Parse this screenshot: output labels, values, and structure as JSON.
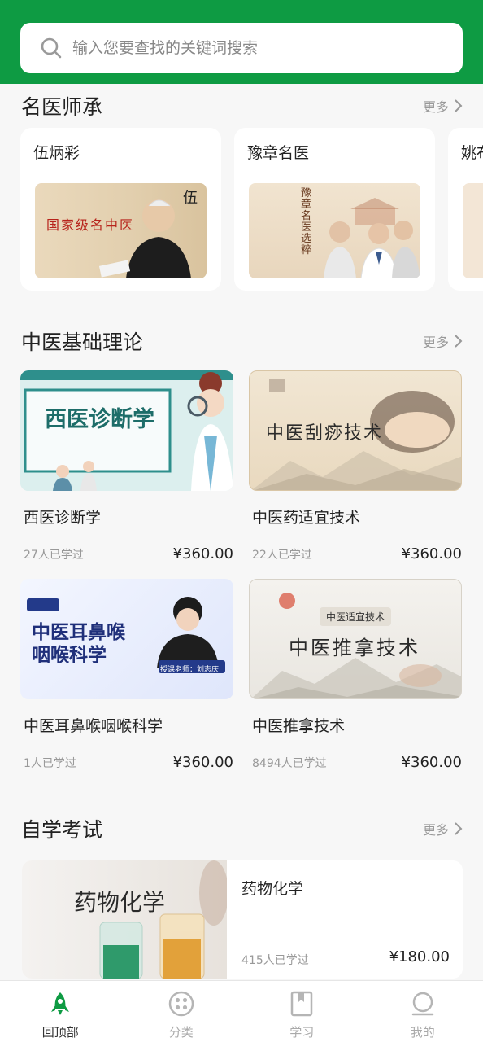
{
  "search": {
    "placeholder": "输入您要查找的关键词搜索"
  },
  "masters": {
    "title": "名医师承",
    "more": "更多",
    "cards": [
      {
        "name": "伍炳彩",
        "image_caption": "国家级名中医"
      },
      {
        "name": "豫章名医",
        "image_caption": "豫章名医选粹"
      },
      {
        "name": "姚布"
      }
    ]
  },
  "basics": {
    "title": "中医基础理论",
    "more": "更多",
    "courses": [
      {
        "title": "西医诊断学",
        "learned": "27人已学过",
        "price": "¥360.00",
        "cover_text": "西医诊断学"
      },
      {
        "title": "中医药适宜技术",
        "learned": "22人已学过",
        "price": "¥360.00",
        "cover_text": "中医刮痧技术"
      },
      {
        "title": "中医耳鼻喉咽喉科学",
        "learned": "1人已学过",
        "price": "¥360.00",
        "cover_text_1": "中医耳鼻喉",
        "cover_text_2": "咽喉科学",
        "cover_badge": "授课老师：刘志庆"
      },
      {
        "title": "中医推拿技术",
        "learned": "8494人已学过",
        "price": "¥360.00",
        "cover_tag": "中医适宜技术",
        "cover_text": "中医推拿技术"
      }
    ]
  },
  "exam": {
    "title": "自学考试",
    "more": "更多",
    "course": {
      "title": "药物化学",
      "learned": "415人已学过",
      "price": "¥180.00",
      "cover_text": "药物化学"
    }
  },
  "tabs": [
    {
      "label": "回顶部",
      "icon": "rocket-icon"
    },
    {
      "label": "分类",
      "icon": "category-icon"
    },
    {
      "label": "学习",
      "icon": "book-icon"
    },
    {
      "label": "我的",
      "icon": "profile-icon"
    }
  ],
  "colors": {
    "brand": "#0e9b43",
    "background": "#f7f7f7"
  }
}
